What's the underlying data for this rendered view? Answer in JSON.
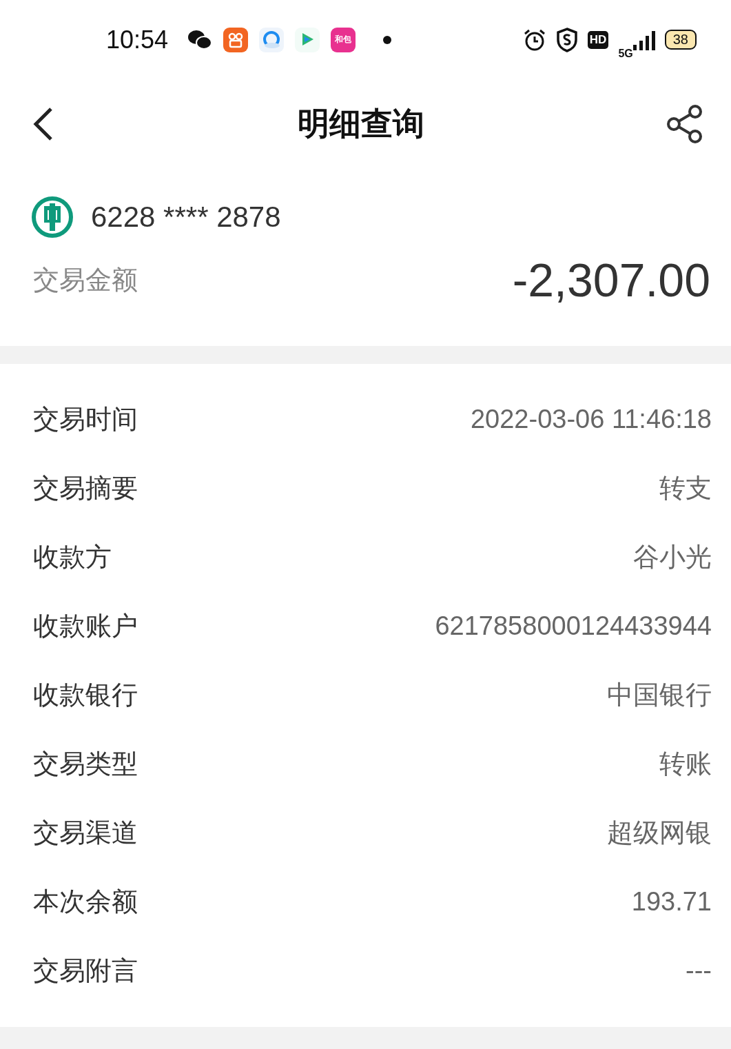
{
  "status_bar": {
    "time": "10:54",
    "app_badge": "和包",
    "network": "5G",
    "hd": "HD",
    "battery": "38"
  },
  "header": {
    "title": "明细查询"
  },
  "account": {
    "number": "6228 **** 2878"
  },
  "amount": {
    "label": "交易金额",
    "value": "-2,307.00"
  },
  "details": [
    {
      "label": "交易时间",
      "value": "2022-03-06 11:46:18"
    },
    {
      "label": "交易摘要",
      "value": "转支"
    },
    {
      "label": "收款方",
      "value": "谷小光"
    },
    {
      "label": "收款账户",
      "value": "6217858000124433944"
    },
    {
      "label": "收款银行",
      "value": "中国银行"
    },
    {
      "label": "交易类型",
      "value": "转账"
    },
    {
      "label": "交易渠道",
      "value": "超级网银"
    },
    {
      "label": "本次余额",
      "value": "193.71"
    },
    {
      "label": "交易附言",
      "value": "---"
    }
  ]
}
